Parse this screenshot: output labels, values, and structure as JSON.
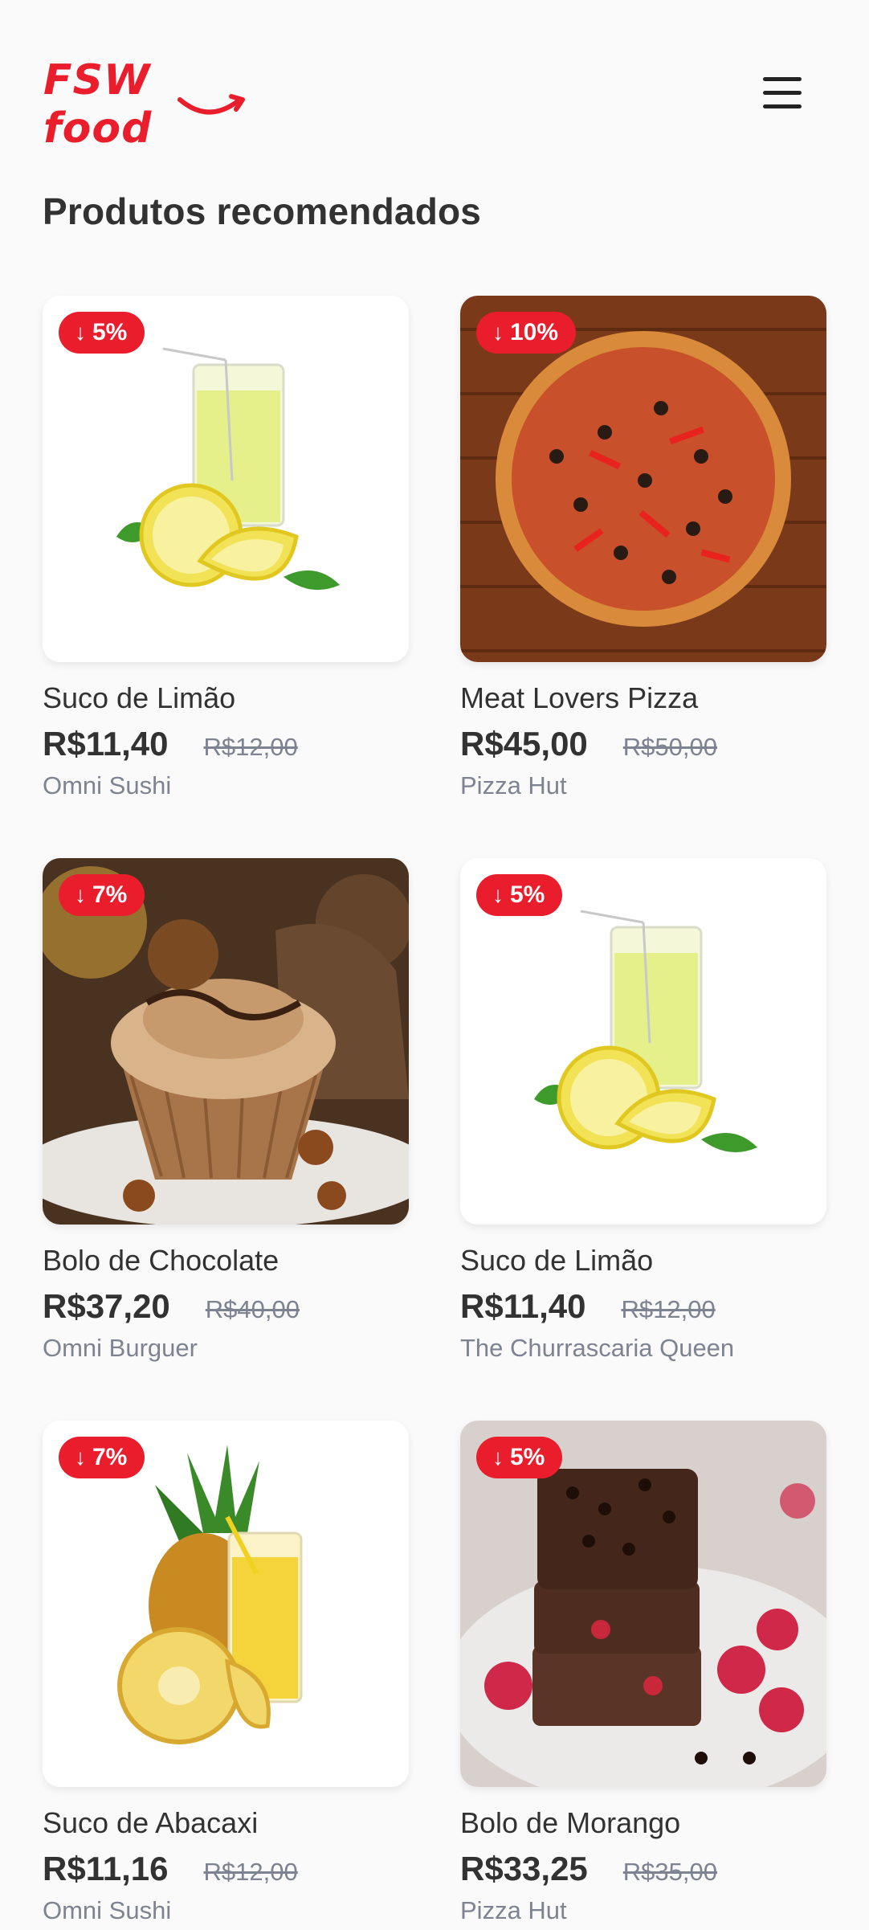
{
  "header": {
    "logo_text": "FSW food",
    "menu_icon": "hamburger-menu-icon"
  },
  "section": {
    "title": "Produtos recomendados"
  },
  "colors": {
    "brand": "#ea1d2c",
    "text": "#323232",
    "muted": "#7e8392"
  },
  "products": [
    {
      "discount": "5%",
      "name": "Suco de Limão",
      "price": "R$11,40",
      "old_price": "R$12,00",
      "restaurant": "Omni Sushi",
      "image": "lemon-juice-image"
    },
    {
      "discount": "10%",
      "name": "Meat Lovers Pizza",
      "price": "R$45,00",
      "old_price": "R$50,00",
      "restaurant": "Pizza Hut",
      "image": "pizza-image"
    },
    {
      "discount": "7%",
      "name": "Bolo de Chocolate",
      "price": "R$37,20",
      "old_price": "R$40,00",
      "restaurant": "Omni Burguer",
      "image": "chocolate-cupcake-image"
    },
    {
      "discount": "5%",
      "name": "Suco de Limão",
      "price": "R$11,40",
      "old_price": "R$12,00",
      "restaurant": "The Churrascaria Queen",
      "image": "lemon-juice-image"
    },
    {
      "discount": "7%",
      "name": "Suco de Abacaxi",
      "price": "R$11,16",
      "old_price": "R$12,00",
      "restaurant": "Omni Sushi",
      "image": "pineapple-juice-image"
    },
    {
      "discount": "5%",
      "name": "Bolo de Morango",
      "price": "R$33,25",
      "old_price": "R$35,00",
      "restaurant": "Pizza Hut",
      "image": "brownie-image"
    }
  ]
}
